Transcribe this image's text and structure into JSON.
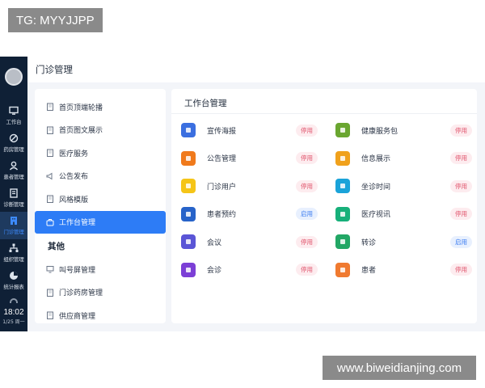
{
  "watermarks": {
    "top_left": "TG: MYYJJPP",
    "bottom_right": "www.biweidianjing.com"
  },
  "rail": {
    "items": [
      {
        "label": "工作台",
        "icon": "monitor-icon"
      },
      {
        "label": "药房管理",
        "icon": "pill-icon"
      },
      {
        "label": "患者管理",
        "icon": "user-icon"
      },
      {
        "label": "诊断管理",
        "icon": "document-icon"
      },
      {
        "label": "门诊管理",
        "icon": "building-icon",
        "active": true
      },
      {
        "label": "组织管理",
        "icon": "org-icon"
      },
      {
        "label": "统计报表",
        "icon": "pie-icon"
      }
    ],
    "time": "18:02",
    "date": "1/25 周一"
  },
  "header": {
    "title": "门诊管理"
  },
  "left_menu": {
    "items": [
      {
        "label": "首页顶端轮播"
      },
      {
        "label": "首页图文展示"
      },
      {
        "label": "医疗服务"
      },
      {
        "label": "公告发布"
      },
      {
        "label": "风格模版"
      },
      {
        "label": "工作台管理",
        "active": true
      }
    ],
    "section_label": "其他",
    "other_items": [
      {
        "label": "叫号屏管理"
      },
      {
        "label": "门诊药房管理"
      },
      {
        "label": "供应商管理"
      }
    ]
  },
  "main": {
    "title": "工作台管理",
    "cards": [
      {
        "name": "宣传海报",
        "status": "停用",
        "state": "off",
        "icon": "poster-icon",
        "color": "#3b6fe0"
      },
      {
        "name": "健康服务包",
        "status": "停用",
        "state": "off",
        "icon": "gift-box-icon",
        "color": "#6aa630"
      },
      {
        "name": "公告管理",
        "status": "停用",
        "state": "off",
        "icon": "megaphone-icon",
        "color": "#f07a1c"
      },
      {
        "name": "信息展示",
        "status": "停用",
        "state": "off",
        "icon": "info-board-icon",
        "color": "#f0a11c"
      },
      {
        "name": "门诊用户",
        "status": "停用",
        "state": "off",
        "icon": "outpatient-user-icon",
        "color": "#f5c518"
      },
      {
        "name": "坐诊时间",
        "status": "停用",
        "state": "off",
        "icon": "schedule-icon",
        "color": "#1aa3d9"
      },
      {
        "name": "患者预约",
        "status": "启用",
        "state": "on",
        "icon": "clock-icon",
        "color": "#2763c9"
      },
      {
        "name": "医疗视讯",
        "status": "停用",
        "state": "off",
        "icon": "medical-video-icon",
        "color": "#17b07a"
      },
      {
        "name": "会议",
        "status": "停用",
        "state": "off",
        "icon": "meeting-icon",
        "color": "#5a55d6"
      },
      {
        "name": "转诊",
        "status": "启用",
        "state": "on",
        "icon": "referral-icon",
        "color": "#22a765"
      },
      {
        "name": "会诊",
        "status": "停用",
        "state": "off",
        "icon": "consultation-icon",
        "color": "#7c3fd6"
      },
      {
        "name": "患者",
        "status": "停用",
        "state": "off",
        "icon": "patient-icon",
        "color": "#f07a30"
      }
    ]
  },
  "colors": {
    "accent": "#2d7cf6",
    "rail_bg": "#0f2036",
    "disabled": "#e0536b",
    "enabled": "#3a7bf0"
  }
}
